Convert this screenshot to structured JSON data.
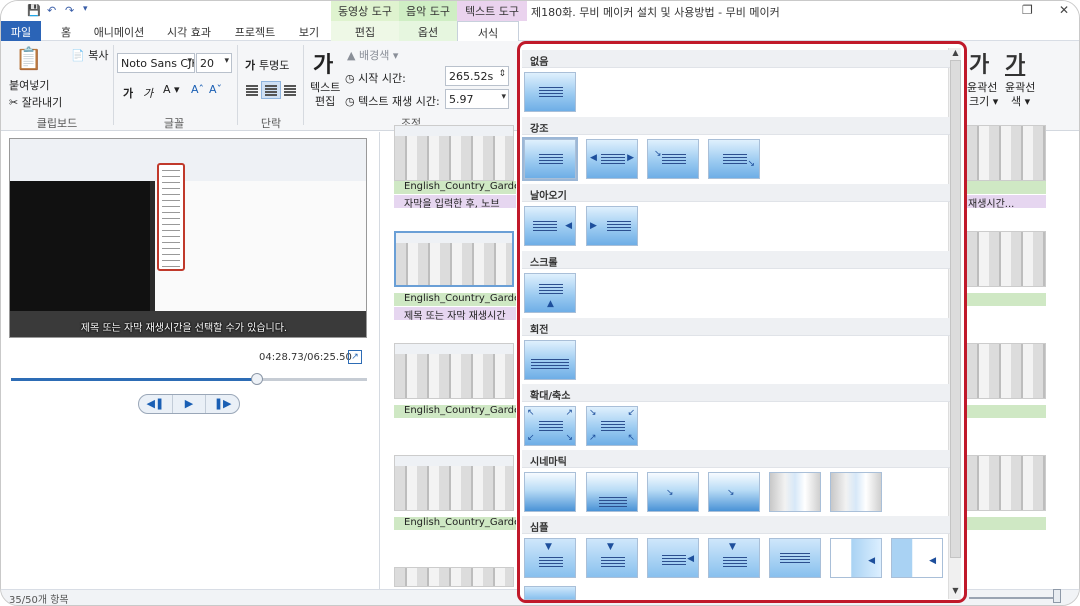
{
  "window": {
    "title": "제180화. 무비 메이커 설치 및 사용방법 - 무비 메이커",
    "context_groups": [
      "동영상 도구",
      "음악 도구",
      "텍스트 도구"
    ]
  },
  "tabs": [
    "파일",
    "홈",
    "애니메이션",
    "시각 효과",
    "프로젝트",
    "보기",
    "편집",
    "옵션",
    "서식"
  ],
  "ribbon": {
    "clipboard": {
      "paste": "붙여넣기",
      "copy": "복사",
      "cut": "잘라내기",
      "label": "클립보드"
    },
    "font": {
      "family": "Noto Sans CJK",
      "size": "20",
      "sample_bold": "가",
      "sample_italic": "가",
      "label": "글꼴"
    },
    "paragraph": {
      "transparency": "투명도",
      "label": "단락"
    },
    "adjust": {
      "edit_text_line1": "텍스트",
      "edit_text_line2": "편집",
      "bg_color": "배경색",
      "start_time_label": "시작 시간:",
      "start_time_value": "265.52s",
      "duration_label": "텍스트 재생 시간:",
      "duration_value": "5.97",
      "label": "조정"
    },
    "right": {
      "big1": "가",
      "big2": "가",
      "outline_size": "윤곽선",
      "outline_size_sub": "크기",
      "outline_color": "윤곽선",
      "outline_color_sub": "색"
    }
  },
  "player": {
    "subtitle": "제목 또는 자막 재생시간을 선택할 수가 있습니다.",
    "timecode": "04:28.73/06:25.50",
    "progress": 0.69
  },
  "storyboard": {
    "clip_caption": "English_Country_Garden",
    "text1": "자막을 입력한 후, 노브",
    "text2": "제목 또는 자막 재생시간",
    "right_text": "재생시간..."
  },
  "gallery": {
    "categories": [
      "없음",
      "강조",
      "날아오기",
      "스크롤",
      "회전",
      "확대/축소",
      "시네마틱",
      "심플"
    ]
  },
  "status": {
    "items": "35/50개 항목"
  }
}
